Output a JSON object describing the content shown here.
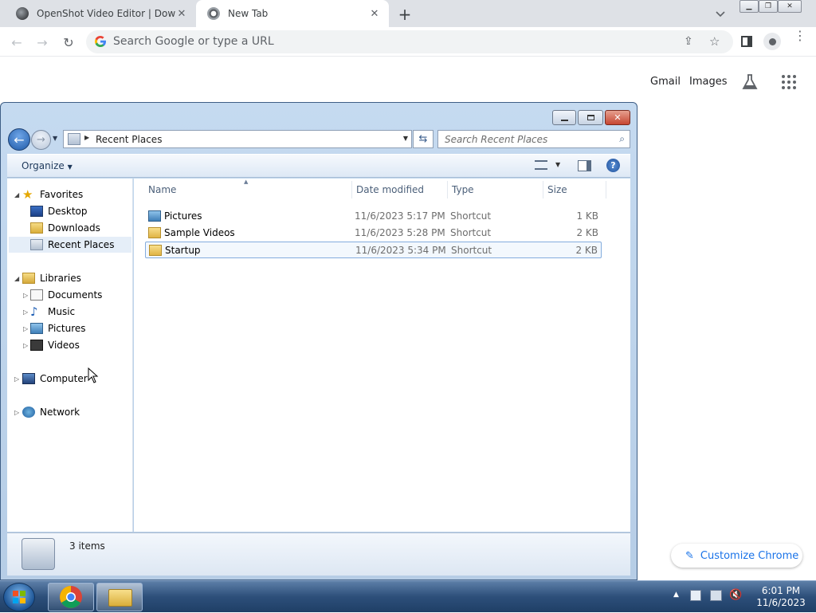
{
  "chrome": {
    "tabs": [
      {
        "title": "OpenShot Video Editor | Downlo"
      },
      {
        "title": "New Tab"
      }
    ],
    "omnibox_placeholder": "Search Google or type a URL"
  },
  "ntp": {
    "gmail": "Gmail",
    "images": "Images",
    "customize": "Customize Chrome"
  },
  "explorer": {
    "address": "Recent Places",
    "search_placeholder": "Search Recent Places",
    "organize": "Organize",
    "nav": {
      "favorites": "Favorites",
      "desktop": "Desktop",
      "downloads": "Downloads",
      "recent_places": "Recent Places",
      "libraries": "Libraries",
      "documents": "Documents",
      "music": "Music",
      "pictures": "Pictures",
      "videos": "Videos",
      "computer": "Computer",
      "network": "Network"
    },
    "columns": {
      "name": "Name",
      "date": "Date modified",
      "type": "Type",
      "size": "Size"
    },
    "files": [
      {
        "name": "Pictures",
        "date": "11/6/2023 5:17 PM",
        "type": "Shortcut",
        "size": "1 KB"
      },
      {
        "name": "Sample Videos",
        "date": "11/6/2023 5:28 PM",
        "type": "Shortcut",
        "size": "2 KB"
      },
      {
        "name": "Startup",
        "date": "11/6/2023 5:34 PM",
        "type": "Shortcut",
        "size": "2 KB"
      }
    ],
    "item_count": "3 items"
  },
  "taskbar": {
    "time": "6:01 PM",
    "date": "11/6/2023"
  }
}
